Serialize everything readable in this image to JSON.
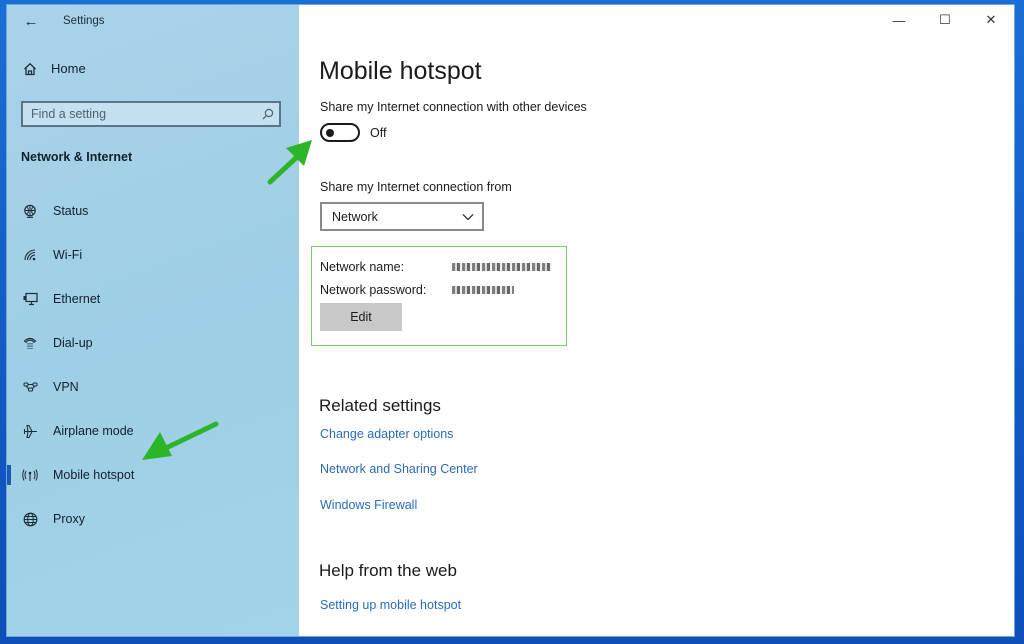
{
  "window": {
    "app_title": "Settings",
    "controls": {
      "minimize": "—",
      "maximize": "☐",
      "close": "✕"
    }
  },
  "sidebar": {
    "back_icon": "←",
    "home": {
      "icon": "⌂",
      "label": "Home"
    },
    "search": {
      "placeholder": "Find a setting",
      "value": "",
      "icon": "⚲"
    },
    "section_title": "Network & Internet",
    "items": [
      {
        "icon": "status-globe",
        "glyph": "◍",
        "label": "Status",
        "selected": false
      },
      {
        "icon": "wifi",
        "glyph": "◜",
        "label": "Wi-Fi",
        "selected": false
      },
      {
        "icon": "ethernet",
        "glyph": "▭",
        "label": "Ethernet",
        "selected": false
      },
      {
        "icon": "dial-up",
        "glyph": "☎",
        "label": "Dial-up",
        "selected": false
      },
      {
        "icon": "vpn",
        "glyph": "∞",
        "label": "VPN",
        "selected": false
      },
      {
        "icon": "airplane",
        "glyph": "✈",
        "label": "Airplane mode",
        "selected": false
      },
      {
        "icon": "mobile-hotspot",
        "glyph": "((·))",
        "label": "Mobile hotspot",
        "selected": true
      },
      {
        "icon": "proxy-globe",
        "glyph": "⊕",
        "label": "Proxy",
        "selected": false
      }
    ]
  },
  "main": {
    "title": "Mobile hotspot",
    "share_label": "Share my Internet connection with other devices",
    "toggle": {
      "state": "Off",
      "on": false
    },
    "share_from_label": "Share my Internet connection from",
    "share_from_value": "Network",
    "network_info": {
      "name_label": "Network name:",
      "name_value": "[obscured]",
      "password_label": "Network password:",
      "password_value": "[obscured]",
      "edit_label": "Edit"
    },
    "related": {
      "heading": "Related settings",
      "links": [
        "Change adapter options",
        "Network and Sharing Center",
        "Windows Firewall"
      ]
    },
    "help": {
      "heading": "Help from the web",
      "links": [
        "Setting up mobile hotspot"
      ]
    }
  },
  "annotations": {
    "arrow_color": "#2db52a"
  },
  "colors": {
    "accent": "#1a5bb5",
    "link": "#2a6cb3",
    "highlight_border": "#72cf6a",
    "desktop": "#1258c4"
  }
}
